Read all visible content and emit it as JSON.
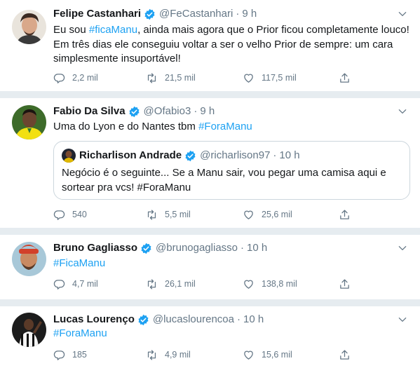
{
  "tweets": [
    {
      "name": "Felipe Castanhari",
      "handle": "@FeCastanhari",
      "time": "9 h",
      "text_parts": [
        {
          "text": "Eu sou ",
          "tag": false
        },
        {
          "text": "#ficaManu",
          "tag": true
        },
        {
          "text": ", ainda mais agora que o Prior ficou completamente louco! Em três dias ele conseguiu voltar a ser o velho Prior de sempre: um cara simplesmente insuportável!",
          "tag": false
        }
      ],
      "replies": "2,2 mil",
      "retweets": "21,5 mil",
      "likes": "117,5 mil"
    },
    {
      "name": "Fabio Da Silva",
      "handle": "@Ofabio3",
      "time": "9 h",
      "text_parts": [
        {
          "text": "Uma do Lyon e do Nantes tbm ",
          "tag": false
        },
        {
          "text": "#ForaManu",
          "tag": true
        }
      ],
      "quote": {
        "name": "Richarlison Andrade",
        "handle": "@richarlison97",
        "time": "10 h",
        "text_parts": [
          {
            "text": "Negócio é o seguinte... Se a Manu sair, vou pegar uma camisa aqui e sortear pra vcs! ",
            "tag": false
          },
          {
            "text": "#ForaManu",
            "tag": false
          }
        ]
      },
      "replies": "540",
      "retweets": "5,5 mil",
      "likes": "25,6 mil"
    },
    {
      "name": "Bruno Gagliasso",
      "handle": "@brunogagliasso",
      "time": "10 h",
      "text_parts": [
        {
          "text": "#FicaManu",
          "tag": true
        }
      ],
      "replies": "4,7 mil",
      "retweets": "26,1 mil",
      "likes": "138,8 mil"
    },
    {
      "name": "Lucas Lourenço",
      "handle": "@lucaslourencoa",
      "time": "10 h",
      "text_parts": [
        {
          "text": "#ForaManu",
          "tag": true
        }
      ],
      "replies": "185",
      "retweets": "4,9 mil",
      "likes": "15,6 mil"
    }
  ],
  "icons": {
    "verified": "verified-badge-icon",
    "caret": "chevron-down-icon",
    "reply": "reply-icon",
    "retweet": "retweet-icon",
    "like": "heart-icon",
    "share": "share-icon"
  },
  "colors": {
    "accent": "#1da1f2",
    "muted": "#657786",
    "separator": "#e6ecf0"
  },
  "separator": "·"
}
